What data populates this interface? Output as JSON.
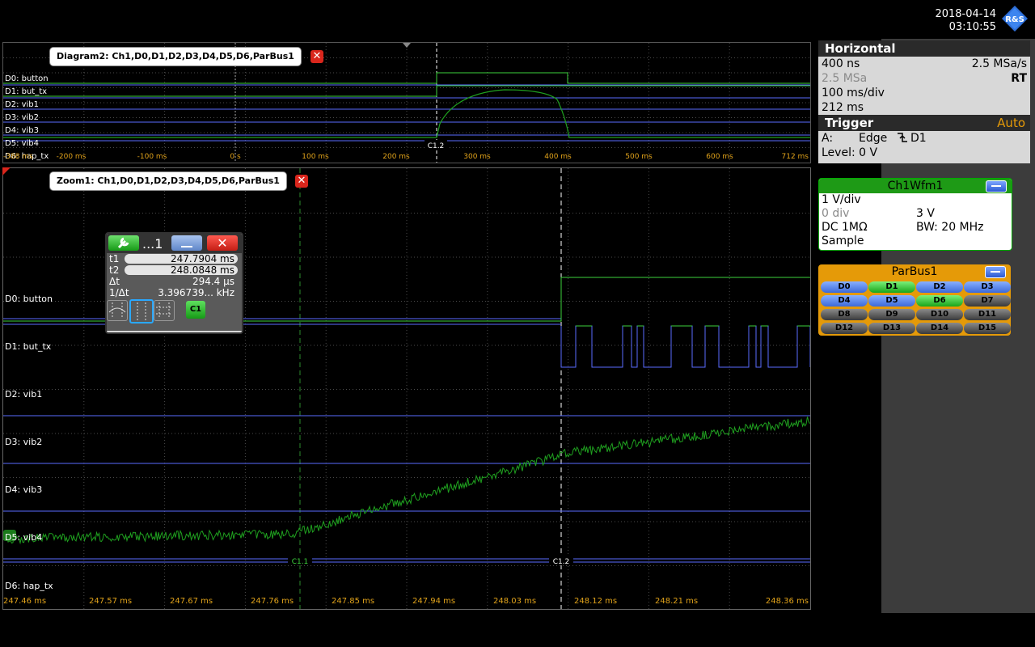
{
  "datetime": {
    "date": "2018-04-14",
    "time": "03:10:55"
  },
  "logo": {
    "text": "R&S"
  },
  "diagram2": {
    "title": "Diagram2: Ch1,D0,D1,D2,D3,D4,D5,D6,ParBus1",
    "close": "✕",
    "channels": [
      "D0: button",
      "D1: but_tx",
      "D2: vib1",
      "D3: vib2",
      "D4: vib3",
      "D5: vib4",
      "D6: hap_tx"
    ],
    "time_ticks": [
      "-388 ms",
      "-200 ms",
      "-100 ms",
      "0 s",
      "100 ms",
      "200 ms",
      "300 ms",
      "400 ms",
      "500 ms",
      "600 ms",
      "712 ms"
    ],
    "cursor_label": "C1.2"
  },
  "zoom1": {
    "title": "Zoom1: Ch1,D0,D1,D2,D3,D4,D5,D6,ParBus1",
    "close": "✕",
    "channels": [
      "D0: button",
      "D1: but_tx",
      "D2: vib1",
      "D3: vib2",
      "D4: vib3",
      "D5: vib4",
      "D6: hap_tx"
    ],
    "time_ticks": [
      "247.46 ms",
      "247.57 ms",
      "247.67 ms",
      "247.76 ms",
      "247.85 ms",
      "247.94 ms",
      "248.03 ms",
      "248.12 ms",
      "248.21 ms",
      "248.36 ms"
    ],
    "cursor1_label": "C1.1",
    "cursor2_label": "C1.2"
  },
  "cursor_box": {
    "title": "...1",
    "rows": [
      {
        "label": "t1",
        "value": "247.7904 ms"
      },
      {
        "label": "t2",
        "value": "248.0848 ms"
      },
      {
        "label": "Δt",
        "value": "294.4 µs"
      },
      {
        "label": "1/Δt",
        "value": "3.396739... kHz"
      }
    ],
    "source": "C1"
  },
  "horizontal": {
    "title": "Horizontal",
    "time_scale": "400 ns",
    "sample_rate": "2.5 MSa/s",
    "record_length": "2.5 MSa",
    "mode": "RT",
    "time_div": "100 ms/div",
    "acq_time": "212 ms"
  },
  "trigger": {
    "title": "Trigger",
    "mode": "Auto",
    "source_label": "A:",
    "type": "Edge",
    "source": "D1",
    "level": "Level: 0 V"
  },
  "ch1wfm": {
    "title": "Ch1Wfm1",
    "vdiv": "1 V/div",
    "offset_div": "0 div",
    "offset_v": "3 V",
    "coupling": "DC 1MΩ",
    "bw": "BW: 20 MHz",
    "acq": "Sample"
  },
  "parbus": {
    "title": "ParBus1",
    "bits": [
      {
        "label": "D0",
        "state": "blue"
      },
      {
        "label": "D1",
        "state": "green"
      },
      {
        "label": "D2",
        "state": "blue"
      },
      {
        "label": "D3",
        "state": "blue"
      },
      {
        "label": "D4",
        "state": "blue"
      },
      {
        "label": "D5",
        "state": "blue"
      },
      {
        "label": "D6",
        "state": "green"
      },
      {
        "label": "D7",
        "state": "grey"
      },
      {
        "label": "D8",
        "state": "grey"
      },
      {
        "label": "D9",
        "state": "grey"
      },
      {
        "label": "D10",
        "state": "grey"
      },
      {
        "label": "D11",
        "state": "grey"
      },
      {
        "label": "D12",
        "state": "grey"
      },
      {
        "label": "D13",
        "state": "grey"
      },
      {
        "label": "D14",
        "state": "grey"
      },
      {
        "label": "D15",
        "state": "grey"
      }
    ]
  },
  "colors": {
    "analog": "#1fa01f",
    "digital_high": "#3cd23c",
    "digital_low": "#5a6cff",
    "tick": "#e0a21a",
    "accent": "#e59a08"
  }
}
